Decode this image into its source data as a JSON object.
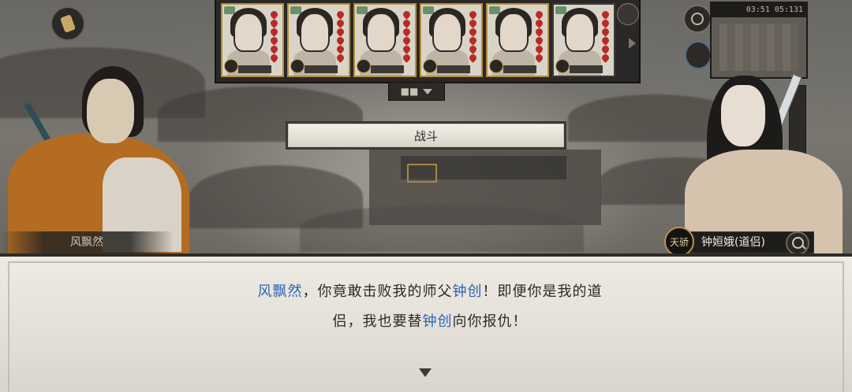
{
  "top_bar": {},
  "roster": {
    "cards": [
      {
        "hearts": 6
      },
      {
        "hearts": 6
      },
      {
        "hearts": 6
      },
      {
        "hearts": 6
      },
      {
        "hearts": 6
      },
      {
        "hearts": 6
      }
    ]
  },
  "minimap": {
    "clock": "03:51 05:131"
  },
  "battle_button": {
    "label": "战斗"
  },
  "speakers": {
    "left": {
      "name": "风飘然"
    },
    "right": {
      "name": "钟姮娥(道侣)",
      "rank": "天骄"
    }
  },
  "dialog": {
    "line1": [
      {
        "text": "风飘然",
        "highlight": true
      },
      {
        "text": "，你竟敢击败我的师父",
        "highlight": false
      },
      {
        "text": "钟创",
        "highlight": true
      },
      {
        "text": "！即便你是我的道",
        "highlight": false
      }
    ],
    "line2": [
      {
        "text": "侣，我也要替",
        "highlight": false
      },
      {
        "text": "钟创",
        "highlight": true
      },
      {
        "text": "向你报仇！",
        "highlight": false
      }
    ]
  },
  "colors": {
    "highlight": "#2a64b8",
    "text": "#2b2a28"
  }
}
